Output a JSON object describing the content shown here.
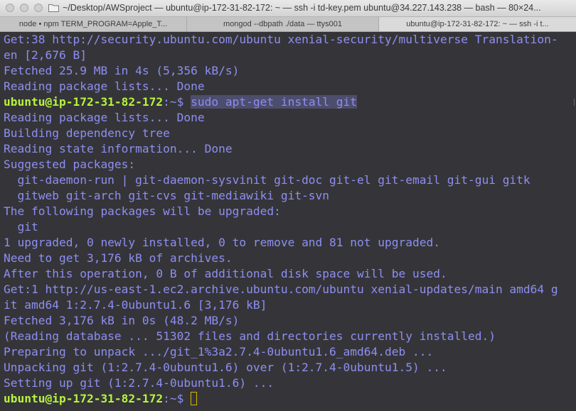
{
  "window": {
    "title": "~/Desktop/AWSproject — ubuntu@ip-172-31-82-172: ~ — ssh -i td-key.pem ubuntu@34.227.143.238 — bash — 80×24..."
  },
  "tabs": [
    {
      "label": "node • npm TERM_PROGRAM=Apple_T..."
    },
    {
      "label": "mongod --dbpath ./data — ttys001"
    },
    {
      "label": "ubuntu@ip-172-31-82-172: ~ — ssh -i t..."
    }
  ],
  "terminal": {
    "prompt_label": "ubuntu@ip-172-31-82-172",
    "prompt_suffix": ":~$ ",
    "command": "sudo apt-get install git",
    "lines": [
      "Get:38 http://security.ubuntu.com/ubuntu xenial-security/multiverse Translation-",
      "en [2,676 B]",
      "Fetched 25.9 MB in 4s (5,356 kB/s)",
      "Reading package lists... Done",
      "",
      "Reading package lists... Done",
      "Building dependency tree",
      "Reading state information... Done",
      "Suggested packages:",
      "  git-daemon-run | git-daemon-sysvinit git-doc git-el git-email git-gui gitk",
      "  gitweb git-arch git-cvs git-mediawiki git-svn",
      "The following packages will be upgraded:",
      "  git",
      "1 upgraded, 0 newly installed, 0 to remove and 81 not upgraded.",
      "Need to get 3,176 kB of archives.",
      "After this operation, 0 B of additional disk space will be used.",
      "Get:1 http://us-east-1.ec2.archive.ubuntu.com/ubuntu xenial-updates/main amd64 g",
      "it amd64 1:2.7.4-0ubuntu1.6 [3,176 kB]",
      "Fetched 3,176 kB in 0s (48.2 MB/s)",
      "(Reading database ... 51302 files and directories currently installed.)",
      "Preparing to unpack .../git_1%3a2.7.4-0ubuntu1.6_amd64.deb ...",
      "Unpacking git (1:2.7.4-0ubuntu1.6) over (1:2.7.4-0ubuntu1.5) ...",
      "Setting up git (1:2.7.4-0ubuntu1.6) ...",
      ""
    ]
  },
  "colors": {
    "background": "#353539",
    "output_text": "#8e8ef2",
    "prompt": "#b8f53c",
    "selection": "#4d4d6d",
    "cursor_outline": "#d6b400"
  }
}
